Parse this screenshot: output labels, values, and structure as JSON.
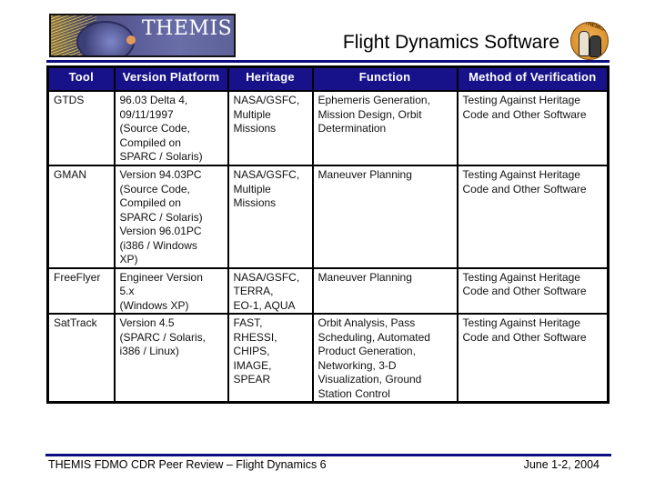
{
  "header": {
    "logo_text": "THEMIS",
    "title": "Flight Dynamics Software",
    "mascot_text": "THEMIS"
  },
  "table": {
    "columns": [
      "Tool",
      "Version Platform",
      "Heritage",
      "Function",
      "Method of Verification"
    ],
    "rows": [
      {
        "tool": "GTDS",
        "version_platform": "96.03 Delta 4,\n09/11/1997\n(Source Code,\nCompiled on\nSPARC / Solaris)",
        "heritage": "NASA/GSFC,\nMultiple\nMissions",
        "function": "Ephemeris Generation,\nMission Design, Orbit\nDetermination",
        "verification": "Testing Against Heritage\nCode and Other Software"
      },
      {
        "tool": "GMAN",
        "version_platform": "Version 94.03PC\n(Source Code,\nCompiled on\nSPARC / Solaris)\nVersion 96.01PC\n(i386 / Windows\nXP)",
        "heritage": "NASA/GSFC,\nMultiple\nMissions",
        "function": "Maneuver Planning",
        "verification": "Testing Against Heritage\nCode and Other Software"
      },
      {
        "tool": "FreeFlyer",
        "version_platform": "Engineer Version\n5.x\n(Windows XP)",
        "heritage": "NASA/GSFC,\nTERRA,\nEO-1, AQUA",
        "function": "Maneuver Planning",
        "verification": "Testing Against Heritage\nCode and Other Software"
      },
      {
        "tool": "SatTrack",
        "version_platform": "Version 4.5\n(SPARC / Solaris,\ni386 / Linux)",
        "heritage": "FAST,\nRHESSI,\nCHIPS,\nIMAGE,\nSPEAR",
        "function": "Orbit Analysis, Pass\nScheduling, Automated\nProduct Generation,\nNetworking, 3-D\nVisualization, Ground\nStation Control",
        "verification": "Testing Against Heritage\nCode and Other Software"
      }
    ]
  },
  "footer": {
    "left": "THEMIS FDMO CDR Peer Review – Flight Dynamics 6",
    "right": "June 1-2, 2004"
  },
  "colors": {
    "header_fill": "#17128a",
    "rule_blue": "#0b0d80"
  }
}
